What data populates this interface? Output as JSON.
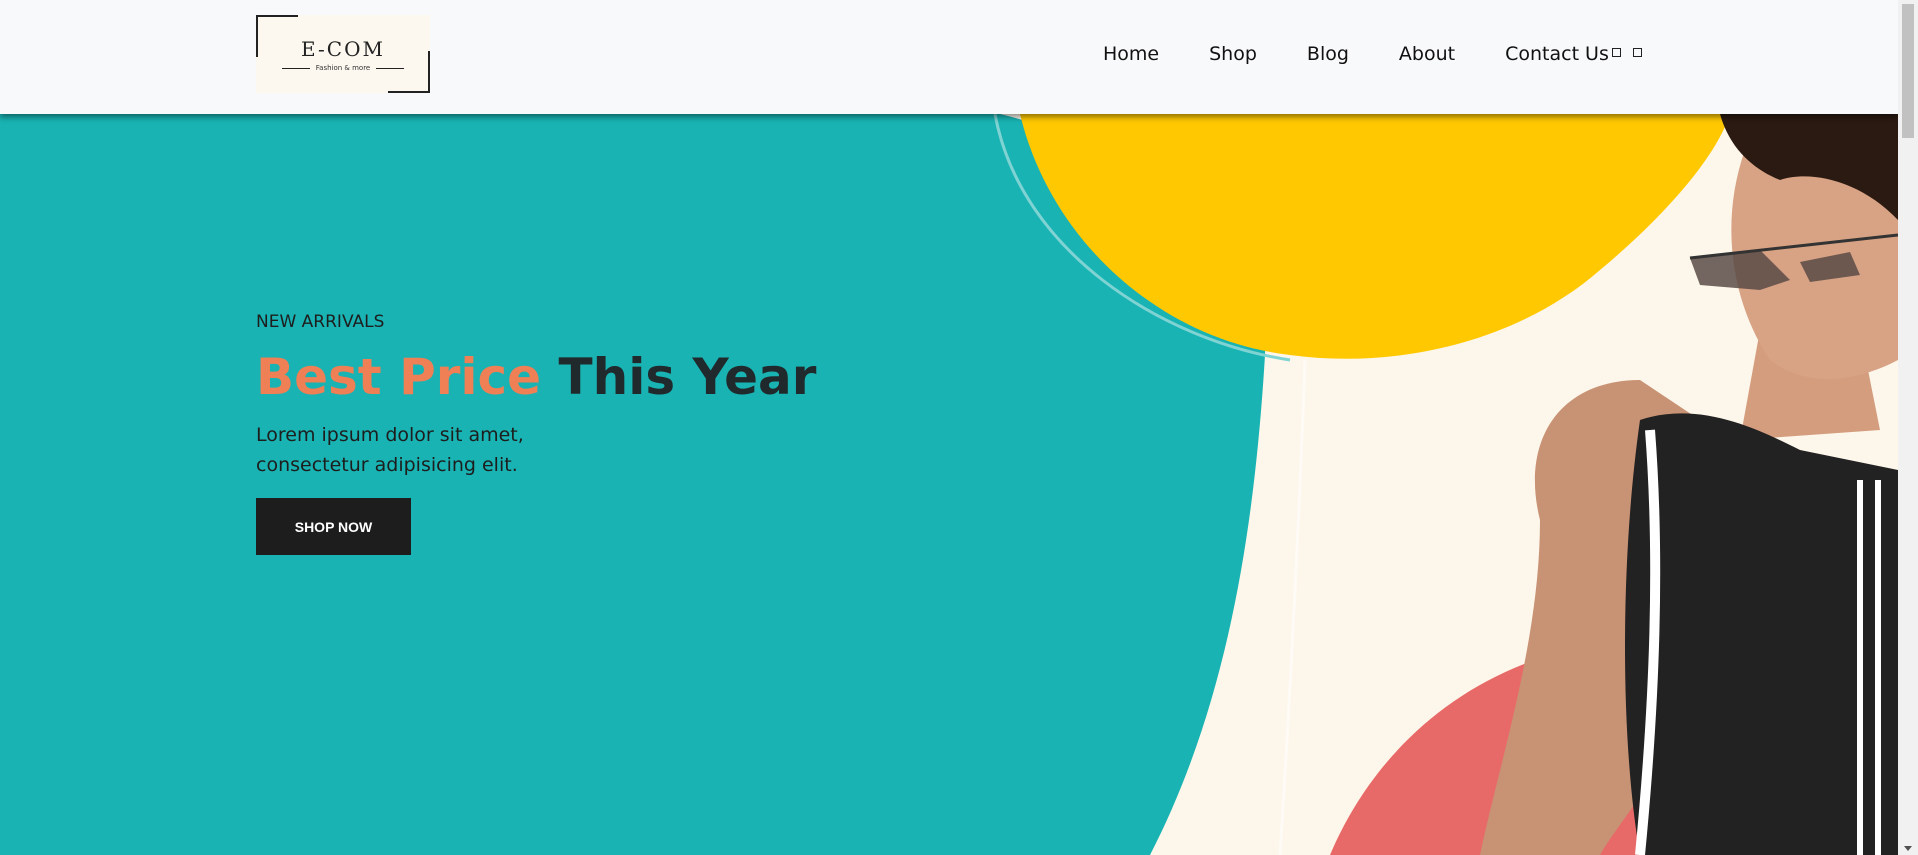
{
  "brand": {
    "name": "E-COM",
    "tagline": "Fashion & more"
  },
  "nav": {
    "items": [
      {
        "label": "Home"
      },
      {
        "label": "Shop"
      },
      {
        "label": "Blog"
      },
      {
        "label": "About"
      },
      {
        "label": "Contact Us"
      }
    ],
    "icons": [
      "user-icon",
      "cart-icon"
    ]
  },
  "hero": {
    "kicker": "NEW ARRIVALS",
    "headline_accent": "Best Price",
    "headline_rest": "This Year",
    "description": "Lorem ipsum dolor sit amet, consectetur adipisicing elit.",
    "cta_label": "SHOP NOW",
    "image": "model-in-sunglasses-and-black-tank-top"
  },
  "colors": {
    "teal": "#19b3b3",
    "yellow": "#ffc800",
    "cream": "#fdf6ea",
    "coral": "#e86a68",
    "accent": "#ef7f55",
    "dark": "#1d1d1d"
  }
}
